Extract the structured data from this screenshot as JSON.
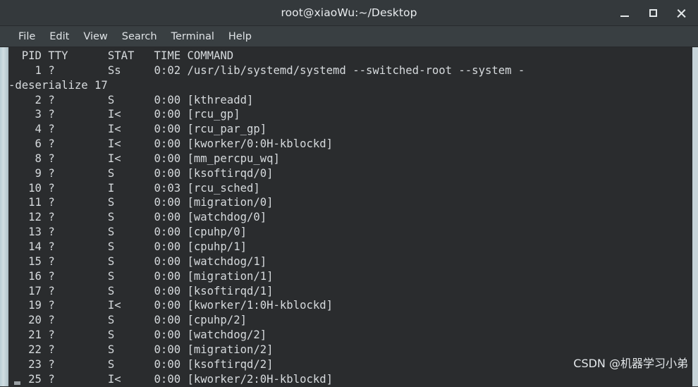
{
  "window": {
    "title": "root@xiaoWu:~/Desktop",
    "controls": [
      {
        "name": "minimize",
        "label": "Minimize"
      },
      {
        "name": "maximize",
        "label": "Maximize"
      },
      {
        "name": "close",
        "label": "Close"
      }
    ],
    "colors": {
      "titlebar_bg": "#34393c",
      "menubar_bg": "#393f42",
      "terminal_bg": "#2a2c2e",
      "terminal_fg": "#d6dadd",
      "scrollbar": "#c6d3d8"
    }
  },
  "menubar": {
    "items": [
      {
        "label": "File"
      },
      {
        "label": "Edit"
      },
      {
        "label": "View"
      },
      {
        "label": "Search"
      },
      {
        "label": "Terminal"
      },
      {
        "label": "Help"
      }
    ]
  },
  "terminal": {
    "columns": [
      "PID",
      "TTY",
      "STAT",
      "TIME",
      "COMMAND"
    ],
    "header_line": "  PID TTY      STAT   TIME COMMAND",
    "lines": [
      "  PID TTY      STAT   TIME COMMAND",
      "    1 ?        Ss     0:02 /usr/lib/systemd/systemd --switched-root --system -",
      "-deserialize 17",
      "    2 ?        S      0:00 [kthreadd]",
      "    3 ?        I<     0:00 [rcu_gp]",
      "    4 ?        I<     0:00 [rcu_par_gp]",
      "    6 ?        I<     0:00 [kworker/0:0H-kblockd]",
      "    8 ?        I<     0:00 [mm_percpu_wq]",
      "    9 ?        S      0:00 [ksoftirqd/0]",
      "   10 ?        I      0:03 [rcu_sched]",
      "   11 ?        S      0:00 [migration/0]",
      "   12 ?        S      0:00 [watchdog/0]",
      "   13 ?        S      0:00 [cpuhp/0]",
      "   14 ?        S      0:00 [cpuhp/1]",
      "   15 ?        S      0:00 [watchdog/1]",
      "   16 ?        S      0:00 [migration/1]",
      "   17 ?        S      0:00 [ksoftirqd/1]",
      "   19 ?        I<     0:00 [kworker/1:0H-kblockd]",
      "   20 ?        S      0:00 [cpuhp/2]",
      "   21 ?        S      0:00 [watchdog/2]",
      "   22 ?        S      0:00 [migration/2]",
      "   23 ?        S      0:00 [ksoftirqd/2]",
      "   25 ?        I<     0:00 [kworker/2:0H-kblockd]"
    ],
    "processes": [
      {
        "pid": "1",
        "tty": "?",
        "stat": "Ss",
        "time": "0:02",
        "command": "/usr/lib/systemd/systemd --switched-root --system --deserialize 17"
      },
      {
        "pid": "2",
        "tty": "?",
        "stat": "S",
        "time": "0:00",
        "command": "[kthreadd]"
      },
      {
        "pid": "3",
        "tty": "?",
        "stat": "I<",
        "time": "0:00",
        "command": "[rcu_gp]"
      },
      {
        "pid": "4",
        "tty": "?",
        "stat": "I<",
        "time": "0:00",
        "command": "[rcu_par_gp]"
      },
      {
        "pid": "6",
        "tty": "?",
        "stat": "I<",
        "time": "0:00",
        "command": "[kworker/0:0H-kblockd]"
      },
      {
        "pid": "8",
        "tty": "?",
        "stat": "I<",
        "time": "0:00",
        "command": "[mm_percpu_wq]"
      },
      {
        "pid": "9",
        "tty": "?",
        "stat": "S",
        "time": "0:00",
        "command": "[ksoftirqd/0]"
      },
      {
        "pid": "10",
        "tty": "?",
        "stat": "I",
        "time": "0:03",
        "command": "[rcu_sched]"
      },
      {
        "pid": "11",
        "tty": "?",
        "stat": "S",
        "time": "0:00",
        "command": "[migration/0]"
      },
      {
        "pid": "12",
        "tty": "?",
        "stat": "S",
        "time": "0:00",
        "command": "[watchdog/0]"
      },
      {
        "pid": "13",
        "tty": "?",
        "stat": "S",
        "time": "0:00",
        "command": "[cpuhp/0]"
      },
      {
        "pid": "14",
        "tty": "?",
        "stat": "S",
        "time": "0:00",
        "command": "[cpuhp/1]"
      },
      {
        "pid": "15",
        "tty": "?",
        "stat": "S",
        "time": "0:00",
        "command": "[watchdog/1]"
      },
      {
        "pid": "16",
        "tty": "?",
        "stat": "S",
        "time": "0:00",
        "command": "[migration/1]"
      },
      {
        "pid": "17",
        "tty": "?",
        "stat": "S",
        "time": "0:00",
        "command": "[ksoftirqd/1]"
      },
      {
        "pid": "19",
        "tty": "?",
        "stat": "I<",
        "time": "0:00",
        "command": "[kworker/1:0H-kblockd]"
      },
      {
        "pid": "20",
        "tty": "?",
        "stat": "S",
        "time": "0:00",
        "command": "[cpuhp/2]"
      },
      {
        "pid": "21",
        "tty": "?",
        "stat": "S",
        "time": "0:00",
        "command": "[watchdog/2]"
      },
      {
        "pid": "22",
        "tty": "?",
        "stat": "S",
        "time": "0:00",
        "command": "[migration/2]"
      },
      {
        "pid": "23",
        "tty": "?",
        "stat": "S",
        "time": "0:00",
        "command": "[ksoftirqd/2]"
      },
      {
        "pid": "25",
        "tty": "?",
        "stat": "I<",
        "time": "0:00",
        "command": "[kworker/2:0H-kblockd]"
      }
    ]
  },
  "watermark": {
    "text": "CSDN @机器学习小弟"
  }
}
